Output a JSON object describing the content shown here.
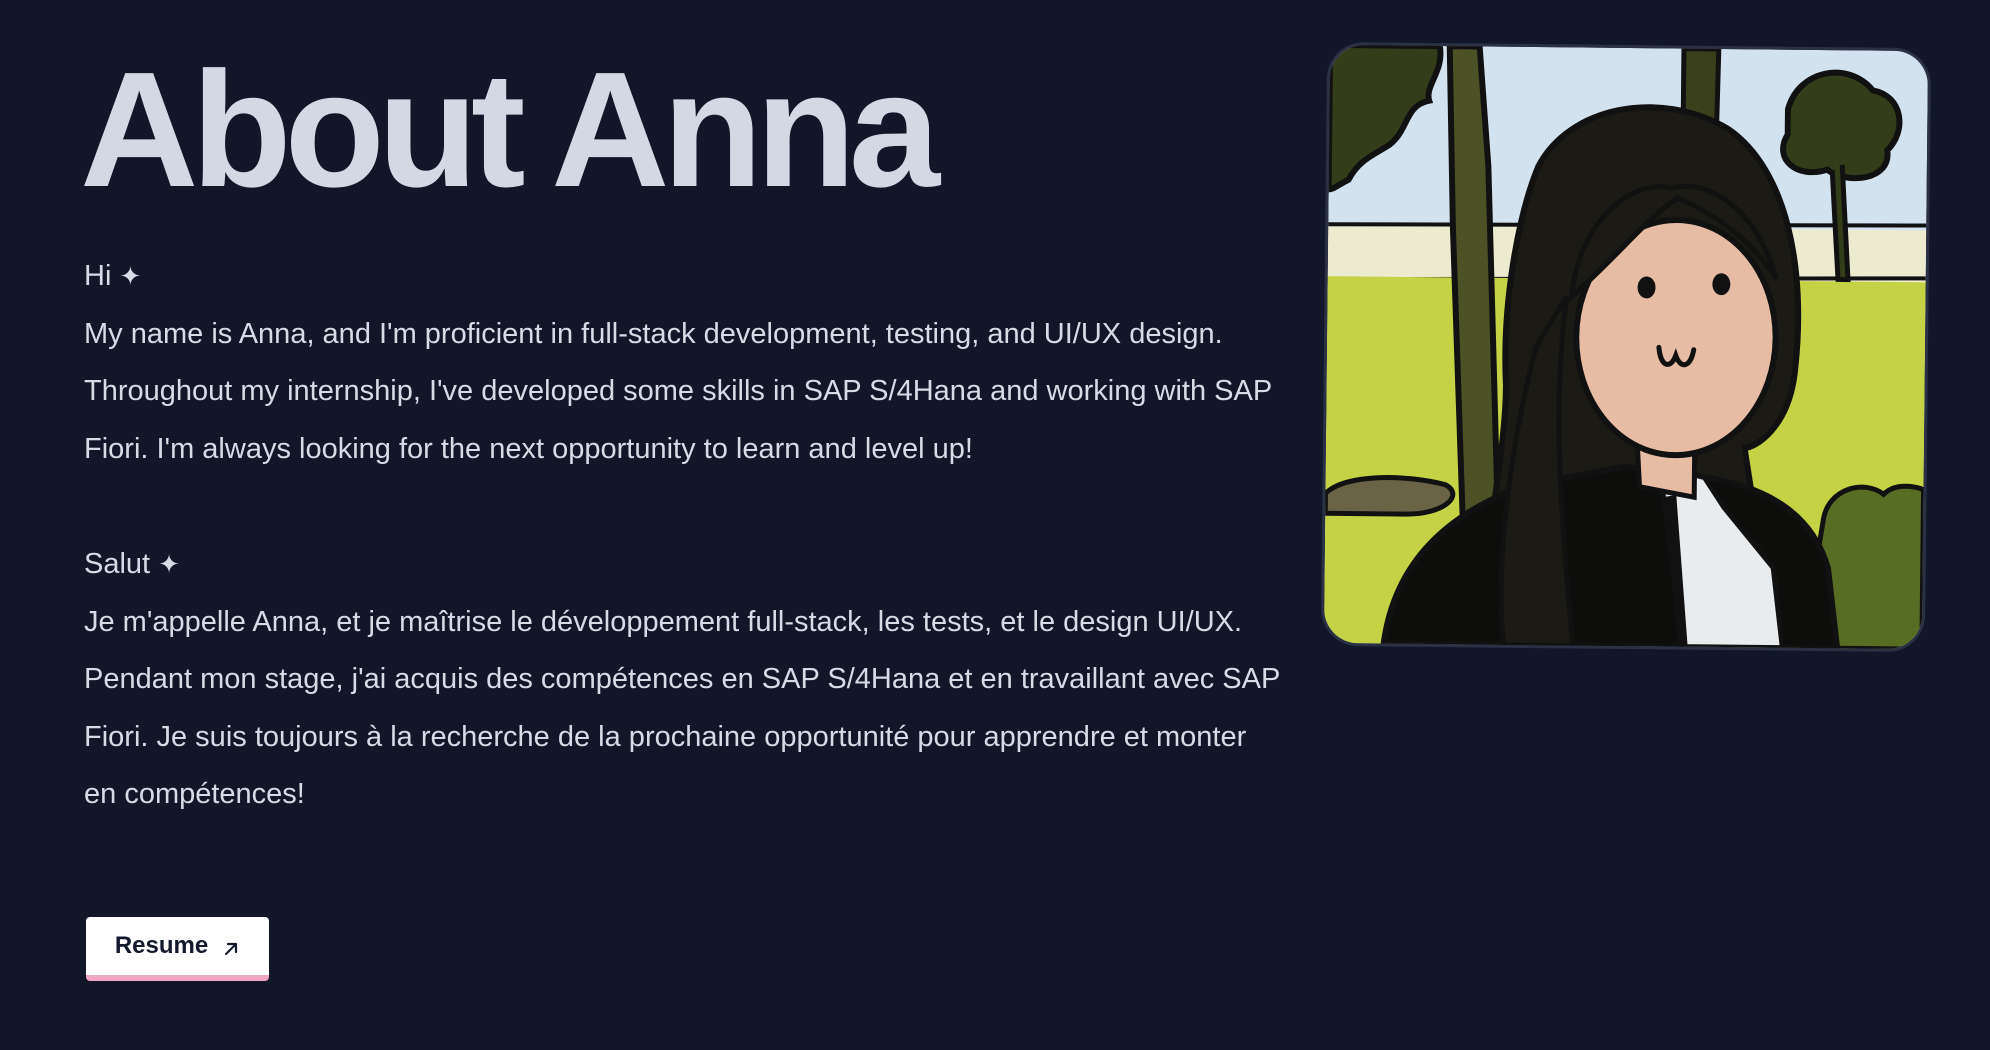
{
  "header": {
    "title": "About Anna"
  },
  "english": {
    "greeting": "Hi",
    "greeting_icon": "sparkle-icon",
    "body": "My name is Anna, and I'm proficient in full-stack development, testing, and UI/UX design. Throughout my internship, I've developed some skills in SAP S/4Hana and working with SAP Fiori. I'm always looking for the next opportunity to learn and level up!"
  },
  "french": {
    "greeting": "Salut",
    "greeting_icon": "sparkle-icon",
    "body": "Je m'appelle Anna, et je maîtrise le développement full-stack, les tests, et le design UI/UX. Pendant mon stage, j'ai acquis des compétences en SAP S/4Hana et en travaillant avec SAP Fiori. Je suis toujours à la recherche de la prochaine opportunité pour apprendre et monter en compétences!"
  },
  "resume_button": {
    "label": "Resume",
    "icon": "arrow-up-right-icon"
  },
  "portrait": {
    "icon": "portrait-illustration"
  },
  "colors": {
    "background": "#111729",
    "heading": "#d3d8e4",
    "text": "#d7dbe6",
    "button_bg": "#ffffff",
    "button_text": "#131a2e",
    "button_underline": "#f2a6c5"
  }
}
